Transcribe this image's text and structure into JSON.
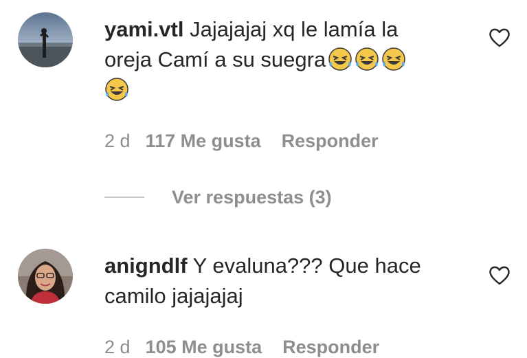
{
  "comments": [
    {
      "username": "yami.vtl",
      "text_line1": "Jajajajaj xq le lamía la",
      "text_line2": "oreja Camí a su suegra",
      "emoji": "rolling-on-floor-laughing-emoji",
      "emoji_count": 4,
      "time": "2 d",
      "likes": "117 Me gusta",
      "reply_label": "Responder",
      "view_replies": "Ver respuestas (3)"
    },
    {
      "username": "anigndlf",
      "text_line1": "Y evaluna??? Que hace",
      "text_line2": "camilo jajajajaj",
      "time": "2 d",
      "likes": "105 Me gusta",
      "reply_label": "Responder"
    }
  ],
  "icons": {
    "like": "heart-outline-icon"
  },
  "colors": {
    "text": "#262626",
    "secondary_text": "#8e8e8e",
    "emoji_face": "#f5c84c"
  }
}
